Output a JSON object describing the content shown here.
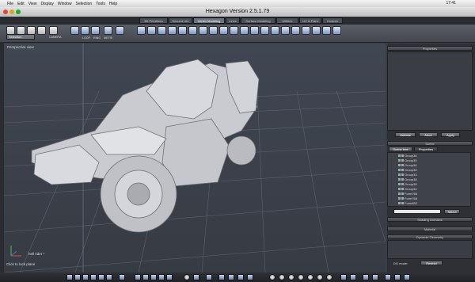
{
  "menubar": {
    "items": [
      "File",
      "Edit",
      "View",
      "Display",
      "Window",
      "Selection",
      "Tools",
      "Help"
    ],
    "clock": "17:41"
  },
  "window": {
    "title": "Hexagon Version 2.5.1.79"
  },
  "tabs": [
    {
      "label": "3D Primitives",
      "active": false
    },
    {
      "label": "Second Life",
      "active": false
    },
    {
      "label": "Vertex Modeling",
      "active": true
    },
    {
      "label": "Lines",
      "active": false
    },
    {
      "label": "Surface Modeling",
      "active": false
    },
    {
      "label": "Utilities",
      "active": false
    },
    {
      "label": "UV & Paint",
      "active": false
    },
    {
      "label": "Custom",
      "active": false
    }
  ],
  "toolbar": {
    "selection_value": "Selection",
    "camera_label": "CAMERA",
    "loop_label": "LOOP",
    "ring_label": "RING",
    "meter_label": "METRI"
  },
  "viewport": {
    "label": "Perspective view",
    "object_name": "hell rider *",
    "hint": "Click to lock plane"
  },
  "right_panel": {
    "properties_title": "Properties",
    "buttons": {
      "validate": "Validate",
      "abort": "Abort",
      "apply": "Apply"
    },
    "scene_title": "Scene",
    "scene_tabs": [
      "Scene tree",
      "Properties"
    ],
    "scene_items": [
      "Group36",
      "Group35",
      "Group36",
      "Group38",
      "Group33",
      "Group38",
      "Group35",
      "Group34",
      "Form766",
      "Form768",
      "Form832"
    ],
    "select_button": "Select",
    "shading_title": "Shading Domains",
    "material_title": "Material",
    "dyn_title": "Dynamic Geometry",
    "dg_label": "DG mode:",
    "dg_value": "Restrict"
  },
  "colors": {
    "accent": "#7f96c0",
    "panel": "#2e3035",
    "viewport": "#3d424c"
  }
}
